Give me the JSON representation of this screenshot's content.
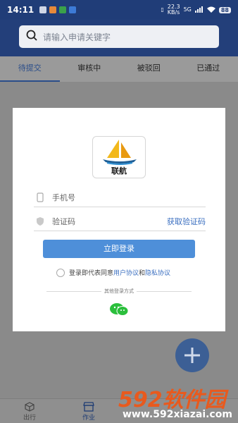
{
  "status_bar": {
    "time": "14:11",
    "network_speed": "22.3\nKB/s",
    "signal": "5G",
    "battery": "88"
  },
  "search": {
    "placeholder": "请输入申请关键字"
  },
  "tabs": [
    {
      "label": "待提交",
      "active": true
    },
    {
      "label": "审核中",
      "active": false
    },
    {
      "label": "被驳回",
      "active": false
    },
    {
      "label": "已通过",
      "active": false
    }
  ],
  "login_dialog": {
    "app_name": "联航",
    "phone_placeholder": "手机号",
    "code_placeholder": "验证码",
    "get_code_label": "获取验证码",
    "login_button_label": "立即登录",
    "agreement_prefix": "登录即代表同意",
    "user_agreement": "用户协议",
    "agreement_and": "和",
    "privacy_policy": "隐私协议",
    "other_login_label": "其他登录方式",
    "wechat_icon": "wechat-icon"
  },
  "bottom_nav": [
    {
      "label": "出行",
      "icon": "box-icon",
      "active": false
    },
    {
      "label": "作业",
      "icon": "store-icon",
      "active": true
    }
  ],
  "fab": {
    "icon": "plus-icon"
  },
  "watermark": {
    "brand": "592软件园",
    "url": "www.592xiazai.com"
  },
  "colors": {
    "header": "#233f7a",
    "accent": "#4e8fd9",
    "link": "#3b6fc0",
    "watermark": "#e85a1e"
  }
}
